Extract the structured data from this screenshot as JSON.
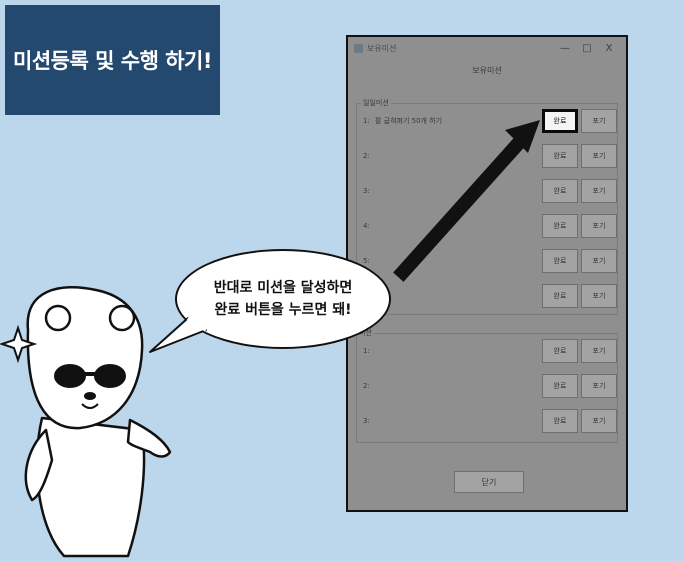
{
  "banner": {
    "title": "미션등록 및 수행 하기!"
  },
  "window": {
    "title": "보유미션",
    "controls": {
      "minimize": "—",
      "maximize": "□",
      "close": "X"
    },
    "heading": "보유미션",
    "group1": {
      "legend": "일일미션",
      "rows": [
        {
          "num": "1:",
          "text": "팔 굽혀펴기 50개 하기"
        },
        {
          "num": "2:",
          "text": ""
        },
        {
          "num": "3:",
          "text": ""
        },
        {
          "num": "4:",
          "text": ""
        },
        {
          "num": "5:",
          "text": ""
        },
        {
          "num": "",
          "text": ""
        }
      ]
    },
    "group2": {
      "legend": "미션",
      "rows": [
        {
          "num": "1:",
          "text": ""
        },
        {
          "num": "2:",
          "text": ""
        },
        {
          "num": "3:",
          "text": ""
        }
      ]
    },
    "complete_label": "완료",
    "giveup_label": "포기",
    "close_label": "닫기"
  },
  "bubble": {
    "line1": "반대로 미션을 달성하면",
    "line2": "완료 버튼을 누르면 돼!"
  },
  "colors": {
    "banner": "#24496f",
    "background": "#bcd6ec",
    "window": "#8f8f8f"
  }
}
